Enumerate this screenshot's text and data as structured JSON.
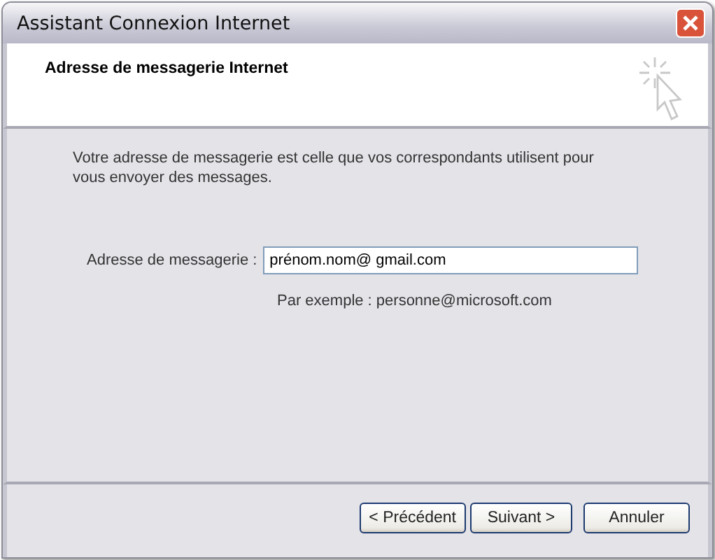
{
  "window": {
    "title": "Assistant Connexion Internet"
  },
  "header": {
    "title": "Adresse de messagerie Internet"
  },
  "intro": "Votre adresse de messagerie est celle que vos correspondants utilisent pour vous envoyer des messages.",
  "email_field": {
    "label": "Adresse de messagerie :",
    "value": "prénom.nom@ gmail.com "
  },
  "example": "Par exemple : personne@microsoft.com",
  "buttons": [
    {
      "label": "< Précédent"
    },
    {
      "label": "Suivant >"
    },
    {
      "label": "Annuler"
    }
  ]
}
